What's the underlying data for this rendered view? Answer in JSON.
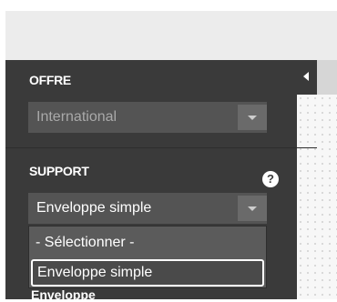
{
  "sidebar": {
    "collapse_icon": "chevron-left-icon",
    "offre": {
      "label": "OFFRE",
      "value": "International",
      "arrow_icon": "chevron-down-icon"
    },
    "support": {
      "label": "SUPPORT",
      "help_icon": "question-circle-icon",
      "help_glyph": "?",
      "value": "Enveloppe simple",
      "arrow_icon": "chevron-down-icon",
      "options": [
        "- Sélectionner -",
        "Enveloppe simple"
      ]
    },
    "next_label": "Enveloppe"
  },
  "colors": {
    "panel_bg": "#3a3a3a",
    "select_bg": "#545454",
    "topbar_bg": "#ececec"
  }
}
